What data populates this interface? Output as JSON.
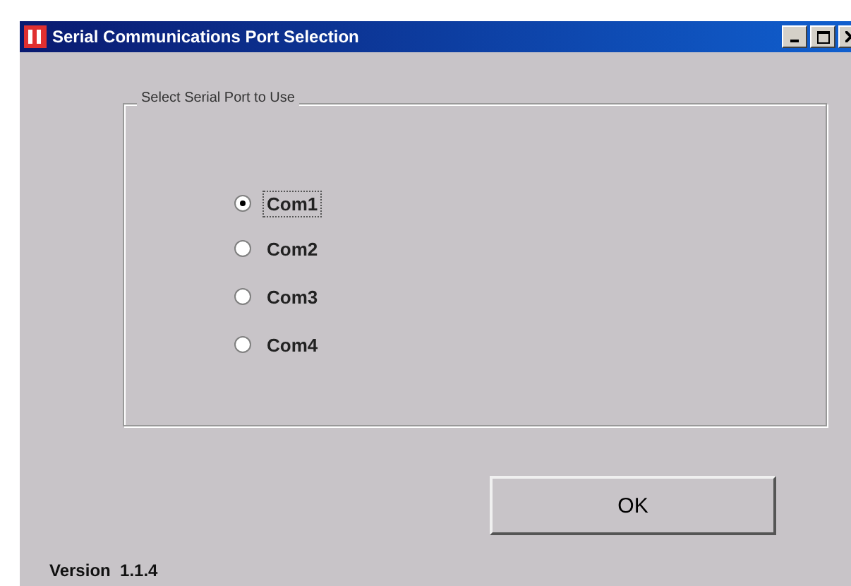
{
  "window": {
    "title": "Serial Communications Port Selection"
  },
  "group": {
    "label": "Select Serial Port to Use",
    "ports": [
      {
        "label": "Com1",
        "selected": true
      },
      {
        "label": "Com2",
        "selected": false
      },
      {
        "label": "Com3",
        "selected": false
      },
      {
        "label": "Com4",
        "selected": false
      }
    ]
  },
  "buttons": [
    "OK"
  ],
  "version": "Version  1.1.4"
}
